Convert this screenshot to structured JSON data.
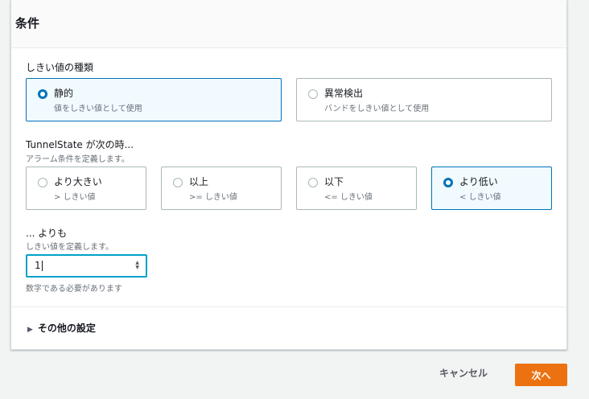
{
  "panel": {
    "title": "条件"
  },
  "threshold_type": {
    "label": "しきい値の種類",
    "options": [
      {
        "title": "静的",
        "sub": "値をしきい値として使用",
        "selected": true
      },
      {
        "title": "異常検出",
        "sub": "バンドをしきい値として使用",
        "selected": false
      }
    ]
  },
  "condition": {
    "label": "TunnelState が次の時...",
    "description": "アラーム条件を定義します。",
    "options": [
      {
        "title": "より大きい",
        "sub": "> しきい値",
        "selected": false
      },
      {
        "title": "以上",
        "sub": ">= しきい値",
        "selected": false
      },
      {
        "title": "以下",
        "sub": "<= しきい値",
        "selected": false
      },
      {
        "title": "より低い",
        "sub": "< しきい値",
        "selected": true
      }
    ]
  },
  "threshold": {
    "label": "... よりも",
    "description": "しきい値を定義します。",
    "value": "1",
    "constraint": "数字である必要があります"
  },
  "additional": {
    "label": "その他の設定"
  },
  "footer": {
    "cancel_label": "キャンセル",
    "next_label": "次へ"
  },
  "colors": {
    "accent": "#0073bb",
    "primary_button": "#ec7211",
    "focus": "#00a1c9"
  }
}
